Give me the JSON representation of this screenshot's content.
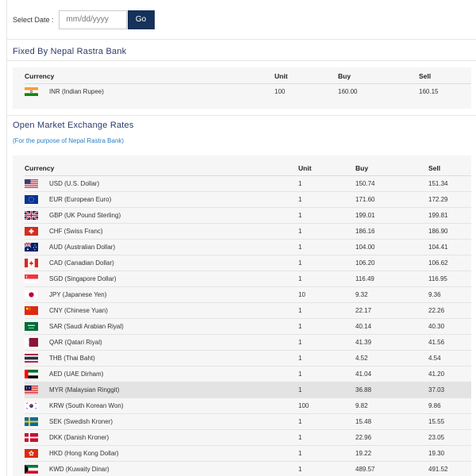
{
  "date_bar": {
    "label": "Select Date :",
    "placeholder": "mm/dd/yyyy",
    "go_label": "Go"
  },
  "fixed_section": {
    "title": "Fixed By Nepal Rastra Bank",
    "headers": {
      "currency": "Currency",
      "unit": "Unit",
      "buy": "Buy",
      "sell": "Sell"
    },
    "rows": [
      {
        "flag": "in-flag-icon",
        "currency": "INR (Indian Rupee)",
        "unit": "100",
        "buy": "160.00",
        "sell": "160.15"
      }
    ]
  },
  "open_section": {
    "title": "Open Market Exchange Rates",
    "subtitle": "(For the purpose of Nepal Rastra Bank)",
    "headers": {
      "currency": "Currency",
      "unit": "Unit",
      "buy": "Buy",
      "sell": "Sell"
    },
    "rows": [
      {
        "flag": "us-flag-icon",
        "currency": "USD (U.S. Dollar)",
        "unit": "1",
        "buy": "150.74",
        "sell": "151.34"
      },
      {
        "flag": "eu-flag-icon",
        "currency": "EUR (European Euro)",
        "unit": "1",
        "buy": "171.60",
        "sell": "172.29"
      },
      {
        "flag": "gb-flag-icon",
        "currency": "GBP (UK Pound Sterling)",
        "unit": "1",
        "buy": "199.01",
        "sell": "199.81"
      },
      {
        "flag": "ch-flag-icon",
        "currency": "CHF (Swiss Franc)",
        "unit": "1",
        "buy": "186.16",
        "sell": "186.90"
      },
      {
        "flag": "au-flag-icon",
        "currency": "AUD (Australian Dollar)",
        "unit": "1",
        "buy": "104.00",
        "sell": "104.41"
      },
      {
        "flag": "ca-flag-icon",
        "currency": "CAD (Canadian Dollar)",
        "unit": "1",
        "buy": "106.20",
        "sell": "106.62"
      },
      {
        "flag": "sg-flag-icon",
        "currency": "SGD (Singapore Dollar)",
        "unit": "1",
        "buy": "116.49",
        "sell": "116.95"
      },
      {
        "flag": "jp-flag-icon",
        "currency": "JPY (Japanese Yen)",
        "unit": "10",
        "buy": "9.32",
        "sell": "9.36"
      },
      {
        "flag": "cn-flag-icon",
        "currency": "CNY (Chinese Yuan)",
        "unit": "1",
        "buy": "22.17",
        "sell": "22.26"
      },
      {
        "flag": "sa-flag-icon",
        "currency": "SAR (Saudi Arabian Riyal)",
        "unit": "1",
        "buy": "40.14",
        "sell": "40.30"
      },
      {
        "flag": "qa-flag-icon",
        "currency": "QAR (Qatari Riyal)",
        "unit": "1",
        "buy": "41.39",
        "sell": "41.56"
      },
      {
        "flag": "th-flag-icon",
        "currency": "THB (Thai Baht)",
        "unit": "1",
        "buy": "4.52",
        "sell": "4.54"
      },
      {
        "flag": "ae-flag-icon",
        "currency": "AED (UAE Dirham)",
        "unit": "1",
        "buy": "41.04",
        "sell": "41.20"
      },
      {
        "flag": "my-flag-icon",
        "currency": "MYR (Malaysian Ringgit)",
        "unit": "1",
        "buy": "36.88",
        "sell": "37.03",
        "highlighted": true
      },
      {
        "flag": "kr-flag-icon",
        "currency": "KRW (South Korean Won)",
        "unit": "100",
        "buy": "9.82",
        "sell": "9.86"
      },
      {
        "flag": "se-flag-icon",
        "currency": "SEK (Swedish Kroner)",
        "unit": "1",
        "buy": "15.48",
        "sell": "15.55"
      },
      {
        "flag": "dk-flag-icon",
        "currency": "DKK (Danish Kroner)",
        "unit": "1",
        "buy": "22.96",
        "sell": "23.05"
      },
      {
        "flag": "hk-flag-icon",
        "currency": "HKD (Hong Kong Dollar)",
        "unit": "1",
        "buy": "19.22",
        "sell": "19.30"
      },
      {
        "flag": "kw-flag-icon",
        "currency": "KWD (Kuwaity Dinar)",
        "unit": "1",
        "buy": "489.57",
        "sell": "491.52"
      }
    ]
  },
  "colors": {
    "go_button": "#16315a",
    "section_title": "#2b3a6b",
    "subtitle": "#2d7fc4",
    "panel_bg": "#f6f6f6",
    "highlight_row": "#e3e3e3"
  }
}
